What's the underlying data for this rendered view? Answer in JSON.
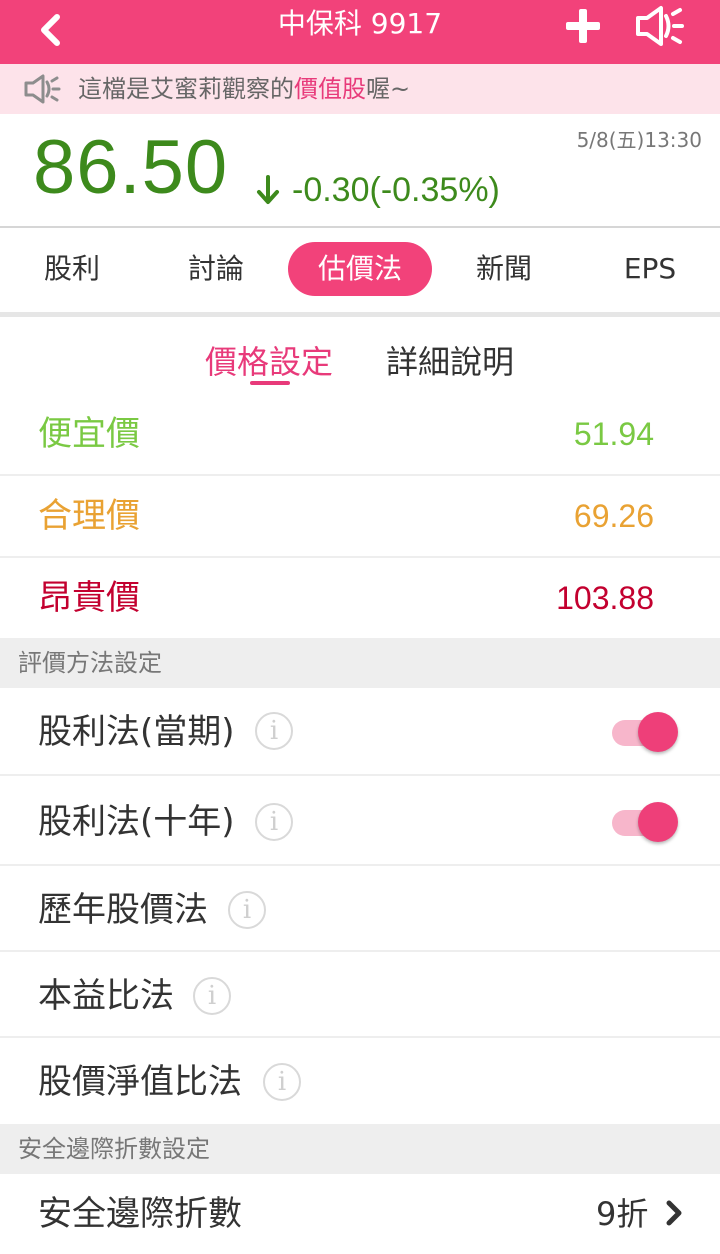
{
  "header": {
    "title": "中保科 9917",
    "back_icon": "chevron-left-icon",
    "add_icon": "plus-icon",
    "speaker_icon": "megaphone-icon",
    "color": "#f2427a"
  },
  "notice": {
    "prefix": "這檔是艾蜜莉觀察的",
    "highlight": "價值股",
    "suffix": "喔~",
    "icon": "megaphone-icon"
  },
  "quote": {
    "price": "86.50",
    "change": "-0.30(-0.35%)",
    "direction_icon": "arrow-down-icon",
    "timestamp": "5/8(五)13:30",
    "color": "#3d8a1c"
  },
  "tabs": [
    {
      "label": "股利",
      "active": false
    },
    {
      "label": "討論",
      "active": false
    },
    {
      "label": "估價法",
      "active": true
    },
    {
      "label": "新聞",
      "active": false
    },
    {
      "label": "EPS",
      "active": false
    }
  ],
  "subtabs": {
    "price_setting": "價格設定",
    "detail": "詳細說明"
  },
  "prices": {
    "cheap": {
      "label": "便宜價",
      "value": "51.94",
      "color": "#7ac943"
    },
    "fair": {
      "label": "合理價",
      "value": "69.26",
      "color": "#e9a233"
    },
    "expensive": {
      "label": "昂貴價",
      "value": "103.88",
      "color": "#c3002f"
    }
  },
  "methods_section": {
    "title": "評價方法設定"
  },
  "methods": [
    {
      "label": "股利法(當期)",
      "info_icon": "info-icon",
      "toggle": true,
      "toggle_on": true
    },
    {
      "label": "股利法(十年)",
      "info_icon": "info-icon",
      "toggle": true,
      "toggle_on": true
    },
    {
      "label": "歷年股價法",
      "info_icon": "info-icon",
      "toggle": false
    },
    {
      "label": "本益比法",
      "info_icon": "info-icon",
      "toggle": false
    },
    {
      "label": "股價淨值比法",
      "info_icon": "info-icon",
      "toggle": false
    }
  ],
  "safety_section": {
    "title": "安全邊際折數設定"
  },
  "safety": {
    "label": "安全邊際折數",
    "value": "9折",
    "chevron_icon": "chevron-right-icon"
  }
}
